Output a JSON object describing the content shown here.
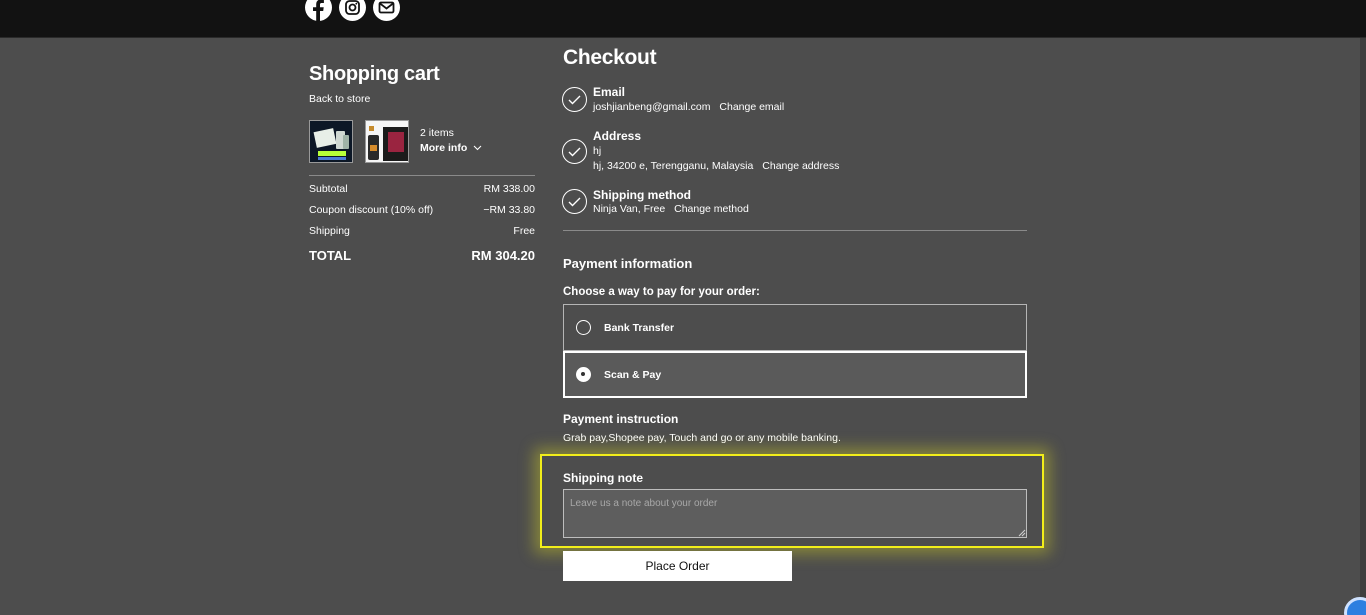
{
  "header": {
    "social_icons": [
      "facebook-icon",
      "instagram-icon",
      "email-icon"
    ]
  },
  "cart": {
    "title": "Shopping cart",
    "back_link": "Back to store",
    "items_count": "2 items",
    "more_info": "More info",
    "summary": {
      "subtotal_label": "Subtotal",
      "subtotal_value": "RM 338.00",
      "coupon_label": "Coupon discount (10% off)",
      "coupon_value": "−RM 33.80",
      "shipping_label": "Shipping",
      "shipping_value": "Free",
      "total_label": "TOTAL",
      "total_value": "RM 304.20"
    }
  },
  "checkout": {
    "title": "Checkout",
    "email": {
      "label": "Email",
      "value": "joshjianbeng@gmail.com",
      "change": "Change email"
    },
    "address": {
      "label": "Address",
      "name": "hj",
      "value": "hj, 34200 e, Terengganu, Malaysia",
      "change": "Change address"
    },
    "shipping_method": {
      "label": "Shipping method",
      "value": "Ninja Van, Free",
      "change": "Change method"
    },
    "payment": {
      "heading": "Payment information",
      "choose_label": "Choose a way to pay for your order:",
      "options": [
        {
          "label": "Bank Transfer",
          "selected": false
        },
        {
          "label": "Scan & Pay",
          "selected": true
        }
      ],
      "instruction_heading": "Payment instruction",
      "instruction_text": "Grab pay,Shopee pay, Touch and go or any mobile banking."
    },
    "shipping_note": {
      "label": "Shipping note",
      "placeholder": "Leave us a note about your order",
      "value": ""
    },
    "place_order": "Place Order"
  },
  "colors": {
    "page_bg": "#4d4d4d",
    "topbar_bg": "#121212",
    "highlight": "#f2ee1a",
    "button_bg": "#ffffff"
  }
}
